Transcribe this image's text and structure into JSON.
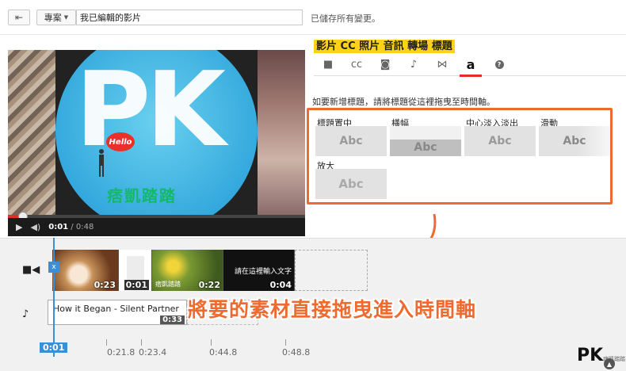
{
  "header": {
    "project_button": "專案",
    "title_value": "我已編輯的影片",
    "save_status": "已儲存所有變更。"
  },
  "player": {
    "hello": "Hello",
    "pk": "PK",
    "brand": "痞凱踏踏",
    "current_time": "0:01",
    "duration": "/ 0:48",
    "progress": 0.05
  },
  "tabs_annotation": "影片 CC 照片 音訊 轉場 標題",
  "tabs": [
    {
      "name": "video",
      "label": "■",
      "icon": "video-camera-icon"
    },
    {
      "name": "cc",
      "label": "cc",
      "icon": "cc-icon"
    },
    {
      "name": "photo",
      "label": "◙",
      "icon": "camera-icon"
    },
    {
      "name": "audio",
      "label": "♪",
      "icon": "music-note-icon"
    },
    {
      "name": "transition",
      "label": "⋈",
      "icon": "transition-icon"
    },
    {
      "name": "title",
      "label": "a",
      "icon": "text-icon",
      "active": true
    },
    {
      "name": "help",
      "label": "?",
      "icon": "help-icon"
    }
  ],
  "hint": "如要新增標題，請將標題從這裡拖曳至時間軸。",
  "presets": [
    {
      "label": "標題置中",
      "thumb": "Abc",
      "style": "center"
    },
    {
      "label": "橫幅",
      "thumb": "Abc",
      "style": "banner"
    },
    {
      "label": "中心淡入淡出",
      "thumb": "Abc",
      "style": "fade"
    },
    {
      "label": "滑動",
      "thumb": "Abc",
      "style": "scroll"
    },
    {
      "label": "放大",
      "thumb": "Abc",
      "style": "zoom"
    }
  ],
  "timeline": {
    "clips": [
      {
        "duration": "0:23"
      },
      {
        "duration": "0:01"
      },
      {
        "duration": "0:22",
        "label": "痞凱踏踏"
      },
      {
        "duration": "0:04",
        "label": "請在這裡輸入文字"
      }
    ],
    "audio_title": "How it Began - Silent Partner",
    "audio_duration": "0:33",
    "playhead_icon": "x",
    "annotation": "將要的素材直接拖曳進入時間軸",
    "current_time": "0:01",
    "ruler": [
      "0:21.8",
      "0:23.4",
      "0:44.8",
      "0:48.8"
    ]
  },
  "logo": {
    "text": "PK",
    "sub": "痞凱踏踏"
  },
  "colors": {
    "accent": "#ef6a2f",
    "playhead": "#3a8fd9",
    "progress": "#e52d27"
  }
}
